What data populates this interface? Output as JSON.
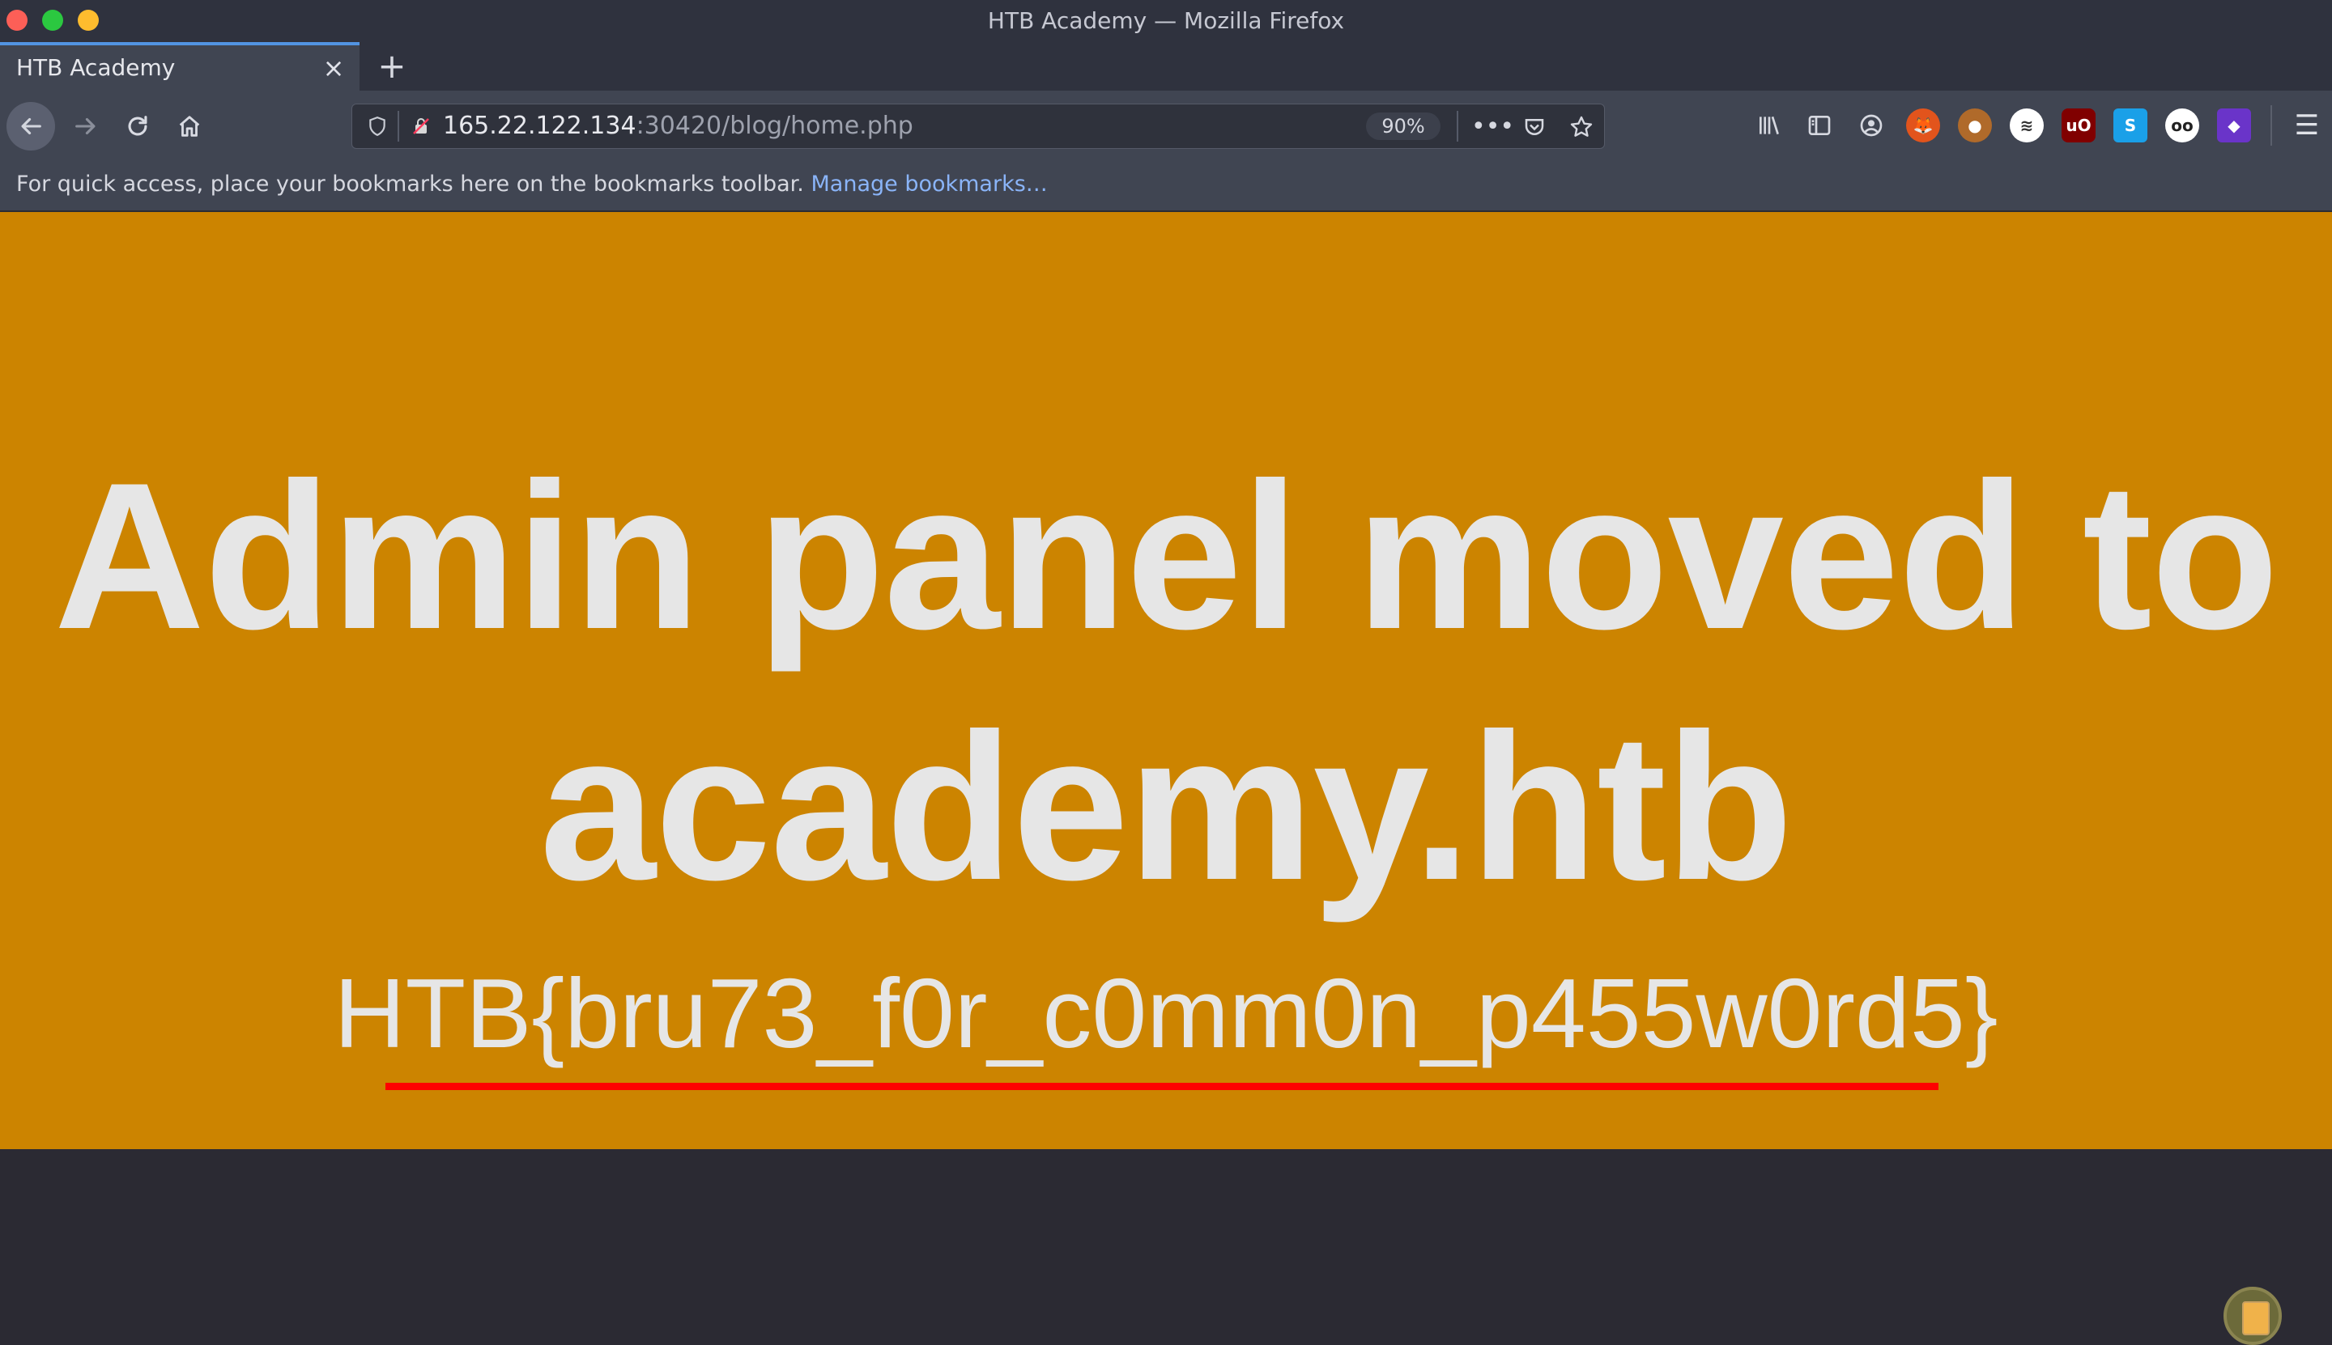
{
  "window": {
    "title": "HTB Academy — Mozilla Firefox"
  },
  "tabs": [
    {
      "label": "HTB Academy",
      "active": true
    }
  ],
  "toolbar": {
    "new_tab_icon": "plus-icon",
    "back_icon": "arrow-left-icon",
    "forward_icon": "arrow-right-icon",
    "reload_icon": "reload-icon",
    "home_icon": "home-icon"
  },
  "urlbar": {
    "host": "165.22.122.134",
    "rest": ":30420/blog/home.php",
    "zoom": "90%"
  },
  "bookmarks_bar": {
    "message": "For quick access, place your bookmarks here on the bookmarks toolbar.",
    "link": "Manage bookmarks…"
  },
  "page": {
    "headline_line1": "Admin panel moved to",
    "headline_line2": "academy.htb",
    "flag": "HTB{bru73_f0r_c0mm0n_p455w0rd5}",
    "background_color": "#cc8400",
    "text_color": "#e6e6e6",
    "underline_color": "#ff0000"
  },
  "extensions": [
    {
      "name": "library-icon"
    },
    {
      "name": "sidebar-icon"
    },
    {
      "name": "account-icon"
    },
    {
      "name": "extension-firefox-icon"
    },
    {
      "name": "extension-cookie-icon"
    },
    {
      "name": "extension-wappalyzer-icon"
    },
    {
      "name": "extension-ublock-icon"
    },
    {
      "name": "extension-s-icon"
    },
    {
      "name": "extension-glasses-icon"
    },
    {
      "name": "extension-cube-icon"
    }
  ]
}
